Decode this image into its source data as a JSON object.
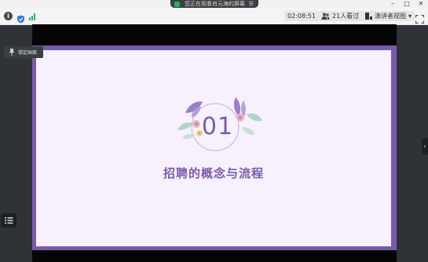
{
  "titlebar": {
    "sharing_text": "您正在观看肖元海的屏幕",
    "window_controls": [
      "minimize",
      "maximize",
      "close"
    ]
  },
  "toolbar": {
    "timer": "02:08:51",
    "viewers": "21人看过",
    "view_mode": "演讲者视图",
    "view_mode_arrow": "▾"
  },
  "sidebar": {
    "pin_label": "锁定画面"
  },
  "slide": {
    "number": "01",
    "title": "招聘的概念与流程",
    "accent_color": "#7a5ab0",
    "background_color": "#f6f1fc"
  },
  "icons": {
    "info": "info-icon",
    "shield": "shield-icon",
    "signal": "signal-icon",
    "pin": "pin-icon",
    "list": "list-icon",
    "fullscreen": "fullscreen-icon",
    "collapse": "chevron-left-icon"
  }
}
